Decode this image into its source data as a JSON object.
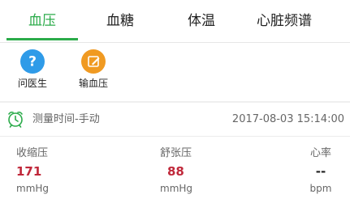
{
  "tabs": [
    {
      "label": "血压",
      "active": true
    },
    {
      "label": "血糖",
      "active": false
    },
    {
      "label": "体温",
      "active": false
    },
    {
      "label": "心脏频谱",
      "active": false
    }
  ],
  "accent_color": "#2bab4a",
  "shortcuts": [
    {
      "label": "问医生",
      "icon": "question-icon",
      "color": "#2f9be8"
    },
    {
      "label": "输血压",
      "icon": "edit-icon",
      "color": "#f09a22"
    }
  ],
  "record": {
    "icon": "alarm-clock-icon",
    "measure_label": "测量时间-手动",
    "time": "2017-08-03 15:14:00"
  },
  "metrics": [
    {
      "name": "收缩压",
      "value": "171",
      "unit": "mmHg"
    },
    {
      "name": "舒张压",
      "value": "88",
      "unit": "mmHg"
    },
    {
      "name": "心率",
      "value": "--",
      "unit": "bpm"
    }
  ],
  "value_color": "#c0283a"
}
